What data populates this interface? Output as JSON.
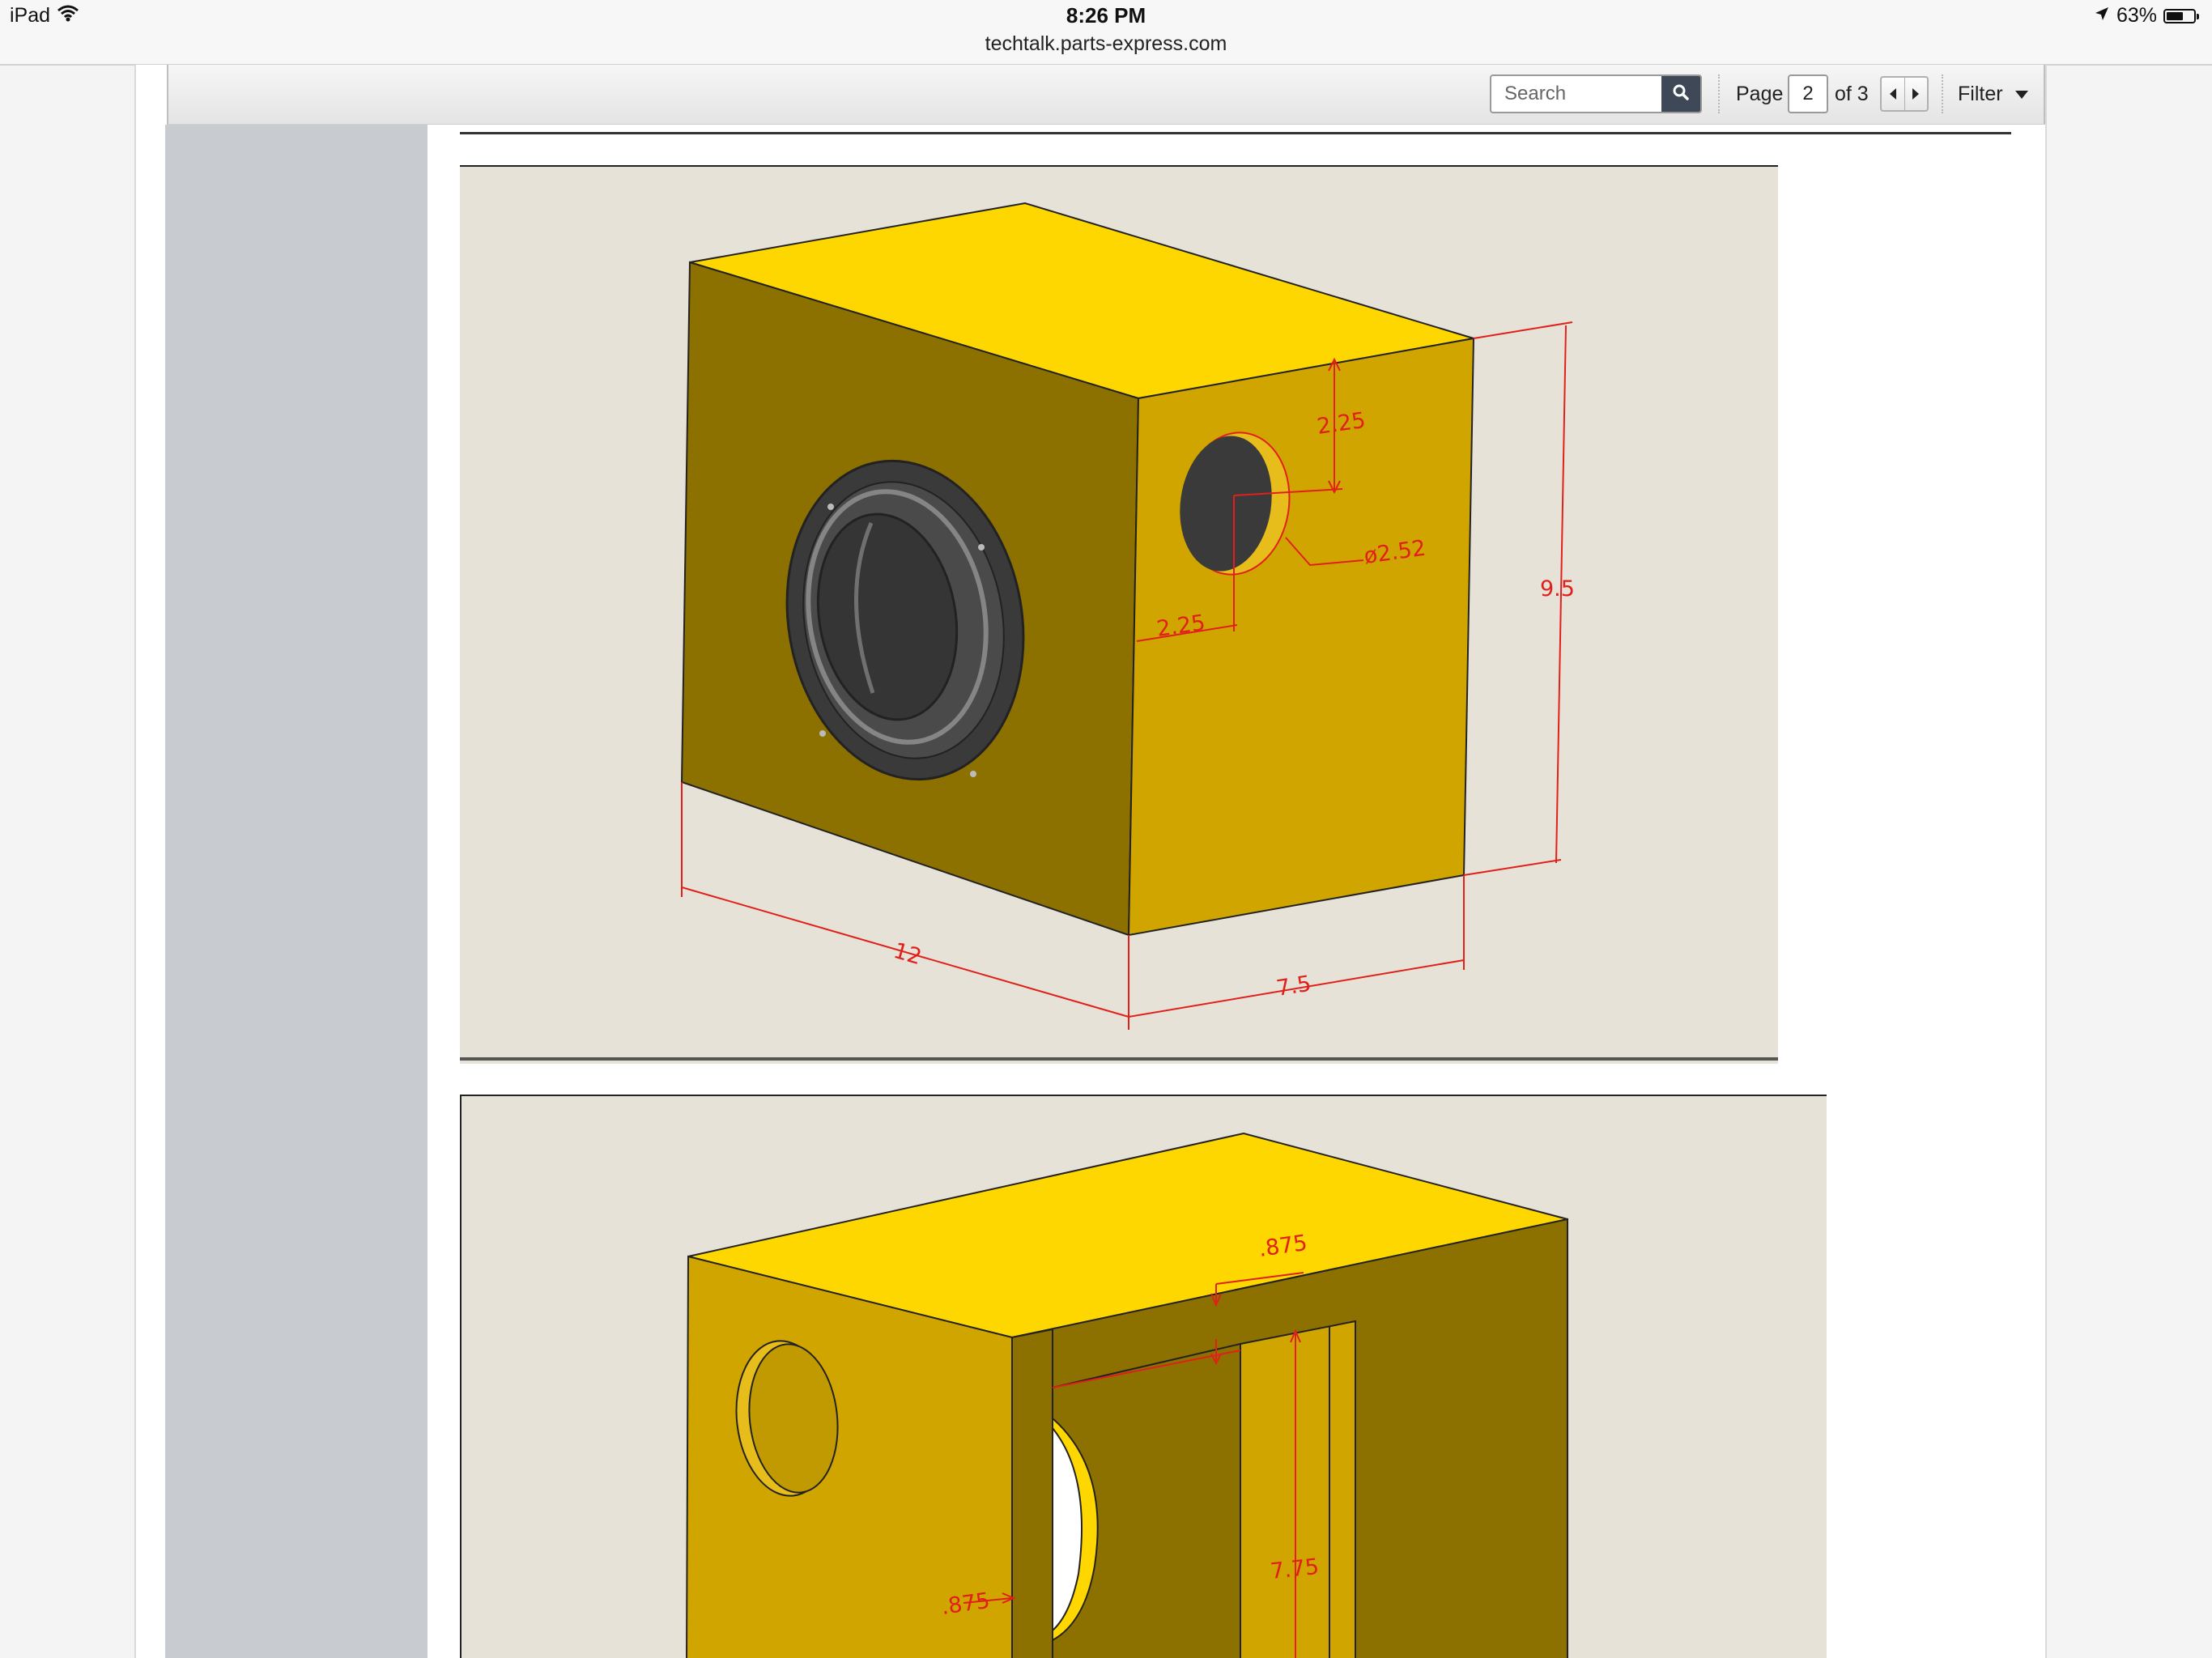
{
  "status_bar": {
    "device": "iPad",
    "time": "8:26 PM",
    "url": "techtalk.parts-express.com",
    "battery_percent": "63%",
    "battery_level": 0.63,
    "icons": [
      "wifi-icon",
      "location-arrow-icon",
      "battery-icon"
    ]
  },
  "toolbar": {
    "search_placeholder": "Search",
    "page_label": "Page",
    "current_page": "2",
    "page_of": "of 3",
    "filter_label": "Filter",
    "icons": [
      "search-icon",
      "prev-page-icon",
      "next-page-icon",
      "filter-dropdown-icon"
    ]
  },
  "drawing1": {
    "dim_top_offset": "2.25",
    "dim_port_diameter": "ø2.52",
    "dim_side_offset": "2.25",
    "dim_height": "9.5",
    "dim_depth": "12",
    "dim_width": "7.5",
    "colors": {
      "top_face": "#ffd700",
      "side_face": "#d1a500",
      "front_face": "#8c7000",
      "dimension": "#e0201b",
      "driver": "#3a3a3a",
      "background": "#e6e2d8"
    }
  },
  "drawing2": {
    "dim_top_thickness": ".875",
    "dim_side_thickness": ".875",
    "dim_inner_height": "7.75"
  }
}
